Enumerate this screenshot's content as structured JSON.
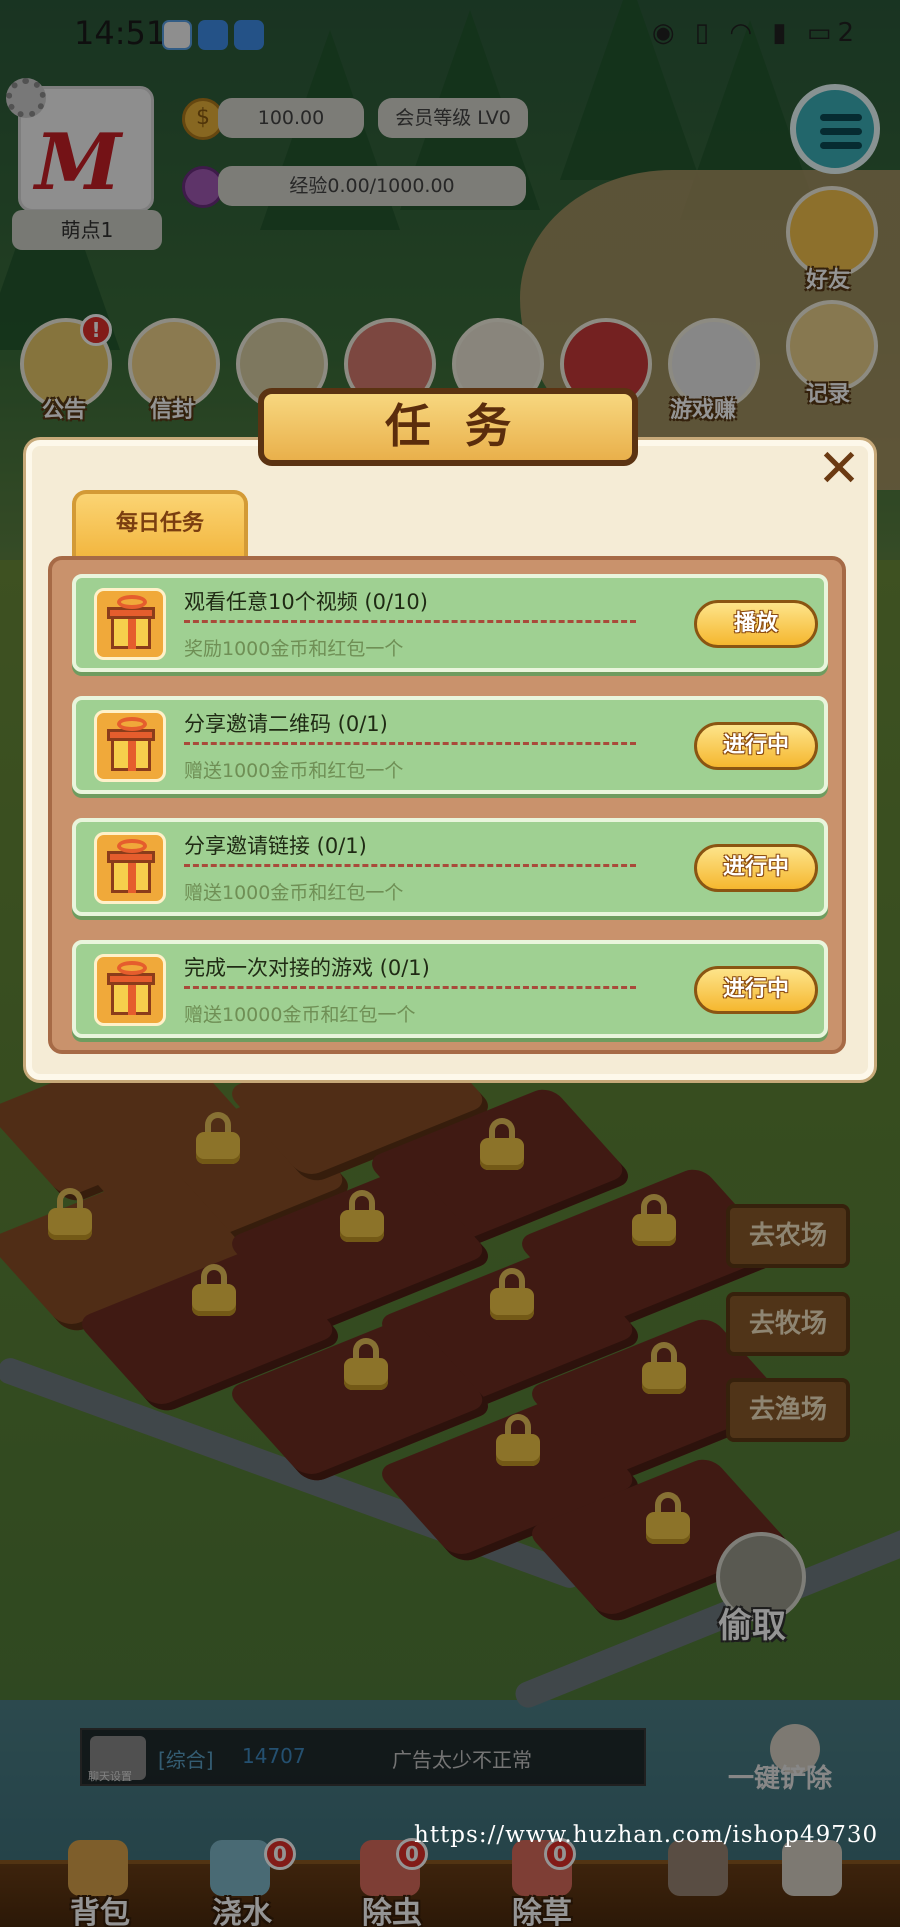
{
  "status_bar": {
    "time": "14:51",
    "battery_text": "2"
  },
  "player": {
    "avatar_logo": "M",
    "nickname": "萌点1",
    "coins": "100.00",
    "vip_level": "会员等级 LV0",
    "experience": "经验0.00/1000.00"
  },
  "top_icons": [
    {
      "label": "公告",
      "badge": "!"
    },
    {
      "label": "信封"
    },
    {
      "label": ""
    },
    {
      "label": ""
    },
    {
      "label": ""
    },
    {
      "label": ""
    },
    {
      "label": "游戏赚"
    }
  ],
  "right_menu": {
    "friends_label": "好友",
    "records_label": "记录"
  },
  "dialog": {
    "title": "任务",
    "close_symbol": "✕",
    "tab_label": "每日任务",
    "tasks": [
      {
        "title": "观看任意10个视频 (0/10)",
        "reward": "奖励1000金币和红包一个",
        "action": "播放"
      },
      {
        "title": "分享邀请二维码 (0/1)",
        "reward": "赠送1000金币和红包一个",
        "action": "进行中"
      },
      {
        "title": "分享邀请链接 (0/1)",
        "reward": "赠送1000金币和红包一个",
        "action": "进行中"
      },
      {
        "title": "完成一次对接的游戏 (0/1)",
        "reward": "赠送10000金币和红包一个",
        "action": "进行中"
      }
    ]
  },
  "side_nav": {
    "farm": "去农场",
    "ranch": "去牧场",
    "fishery": "去渔场",
    "steal": "偷取"
  },
  "chat": {
    "settings_label": "聊天设置",
    "channel": "[综合]",
    "user_id": "14707",
    "message": "广告太少不正常"
  },
  "bottom_bar": {
    "bag": "背包",
    "water": "浇水",
    "water_badge": "0",
    "pest": "除虫",
    "pest_badge": "0",
    "weed": "除草",
    "weed_badge": "0",
    "shovel": "一键铲除"
  },
  "watermark": "https://www.huzhan.com/ishop49730",
  "colors": {
    "accent": "#f2b53d",
    "task_bg": "#9fd092",
    "dialog_bg": "#f5ecd6",
    "title_text": "#5b2d0c"
  },
  "icons": [
    "gear-icon",
    "coin-icon",
    "exp-icon",
    "menu-icon",
    "close-icon",
    "gift-icon",
    "lock-icon",
    "hand-icon",
    "shovel-icon"
  ]
}
